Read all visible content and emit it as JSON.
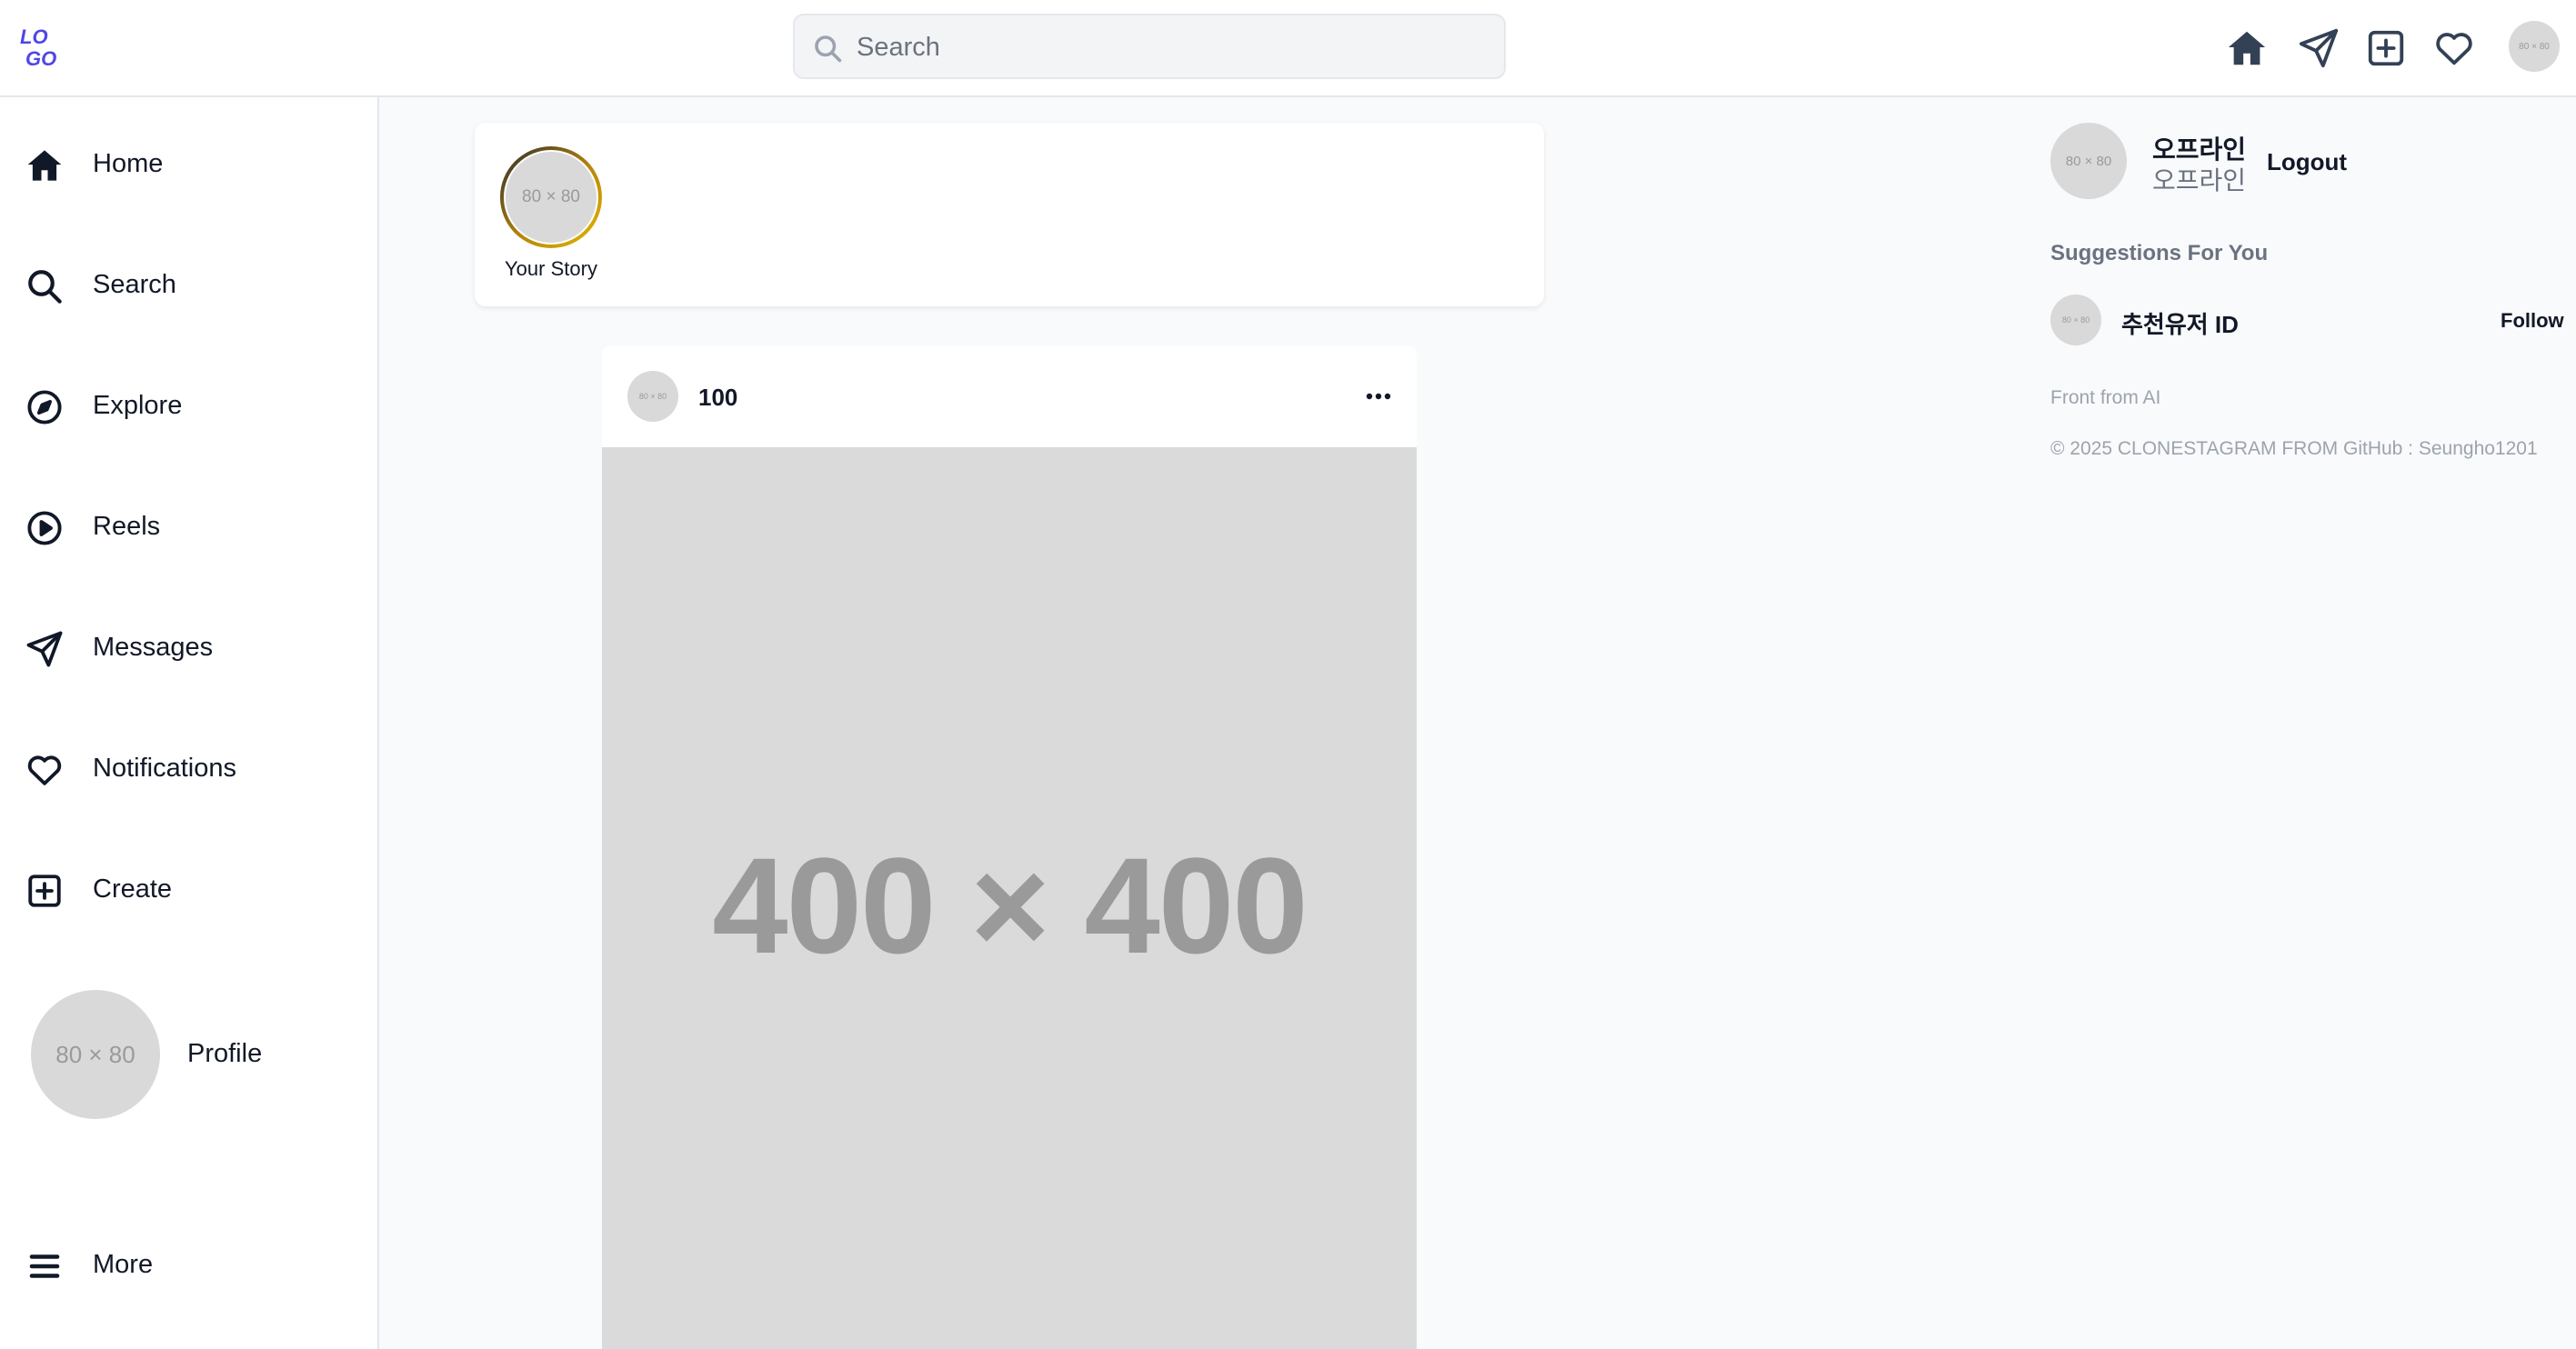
{
  "header": {
    "logo_text": "LOGO",
    "search_placeholder": "Search",
    "avatar_placeholder": "80 × 80",
    "icons": [
      "home-icon",
      "send-icon",
      "plus-square-icon",
      "heart-icon"
    ]
  },
  "sidebar": {
    "items": [
      {
        "label": "Home",
        "icon": "home-icon"
      },
      {
        "label": "Search",
        "icon": "search-icon"
      },
      {
        "label": "Explore",
        "icon": "compass-icon"
      },
      {
        "label": "Reels",
        "icon": "play-circle-icon"
      },
      {
        "label": "Messages",
        "icon": "send-icon"
      },
      {
        "label": "Notifications",
        "icon": "heart-icon"
      },
      {
        "label": "Create",
        "icon": "plus-square-icon"
      }
    ],
    "profile": {
      "label": "Profile",
      "avatar_placeholder": "80 × 80"
    },
    "more": {
      "label": "More",
      "icon": "menu-icon"
    }
  },
  "stories": {
    "your_story": {
      "label": "Your Story",
      "avatar_placeholder": "80 × 80"
    }
  },
  "post": {
    "username": "100",
    "avatar_placeholder": "80 × 80",
    "image_placeholder": "400 × 400"
  },
  "right_panel": {
    "user": {
      "name": "오프라인",
      "subname": "오프라인",
      "avatar_placeholder": "80 × 80"
    },
    "logout_label": "Logout",
    "suggestions_title": "Suggestions For You",
    "suggestions": [
      {
        "name": "추천유저 ID",
        "avatar_placeholder": "80 × 80",
        "follow_label": "Follow"
      }
    ],
    "front_note": "Front from AI",
    "copyright": "© 2025 CLONESTAGRAM FROM GitHub : Seungho1201"
  },
  "colors": {
    "accent": "#4f46e5",
    "icon_dark": "#334155",
    "story_ring": "#b8860b",
    "placeholder_bg": "#d9d9d9",
    "page_bg": "#f9fafb"
  }
}
